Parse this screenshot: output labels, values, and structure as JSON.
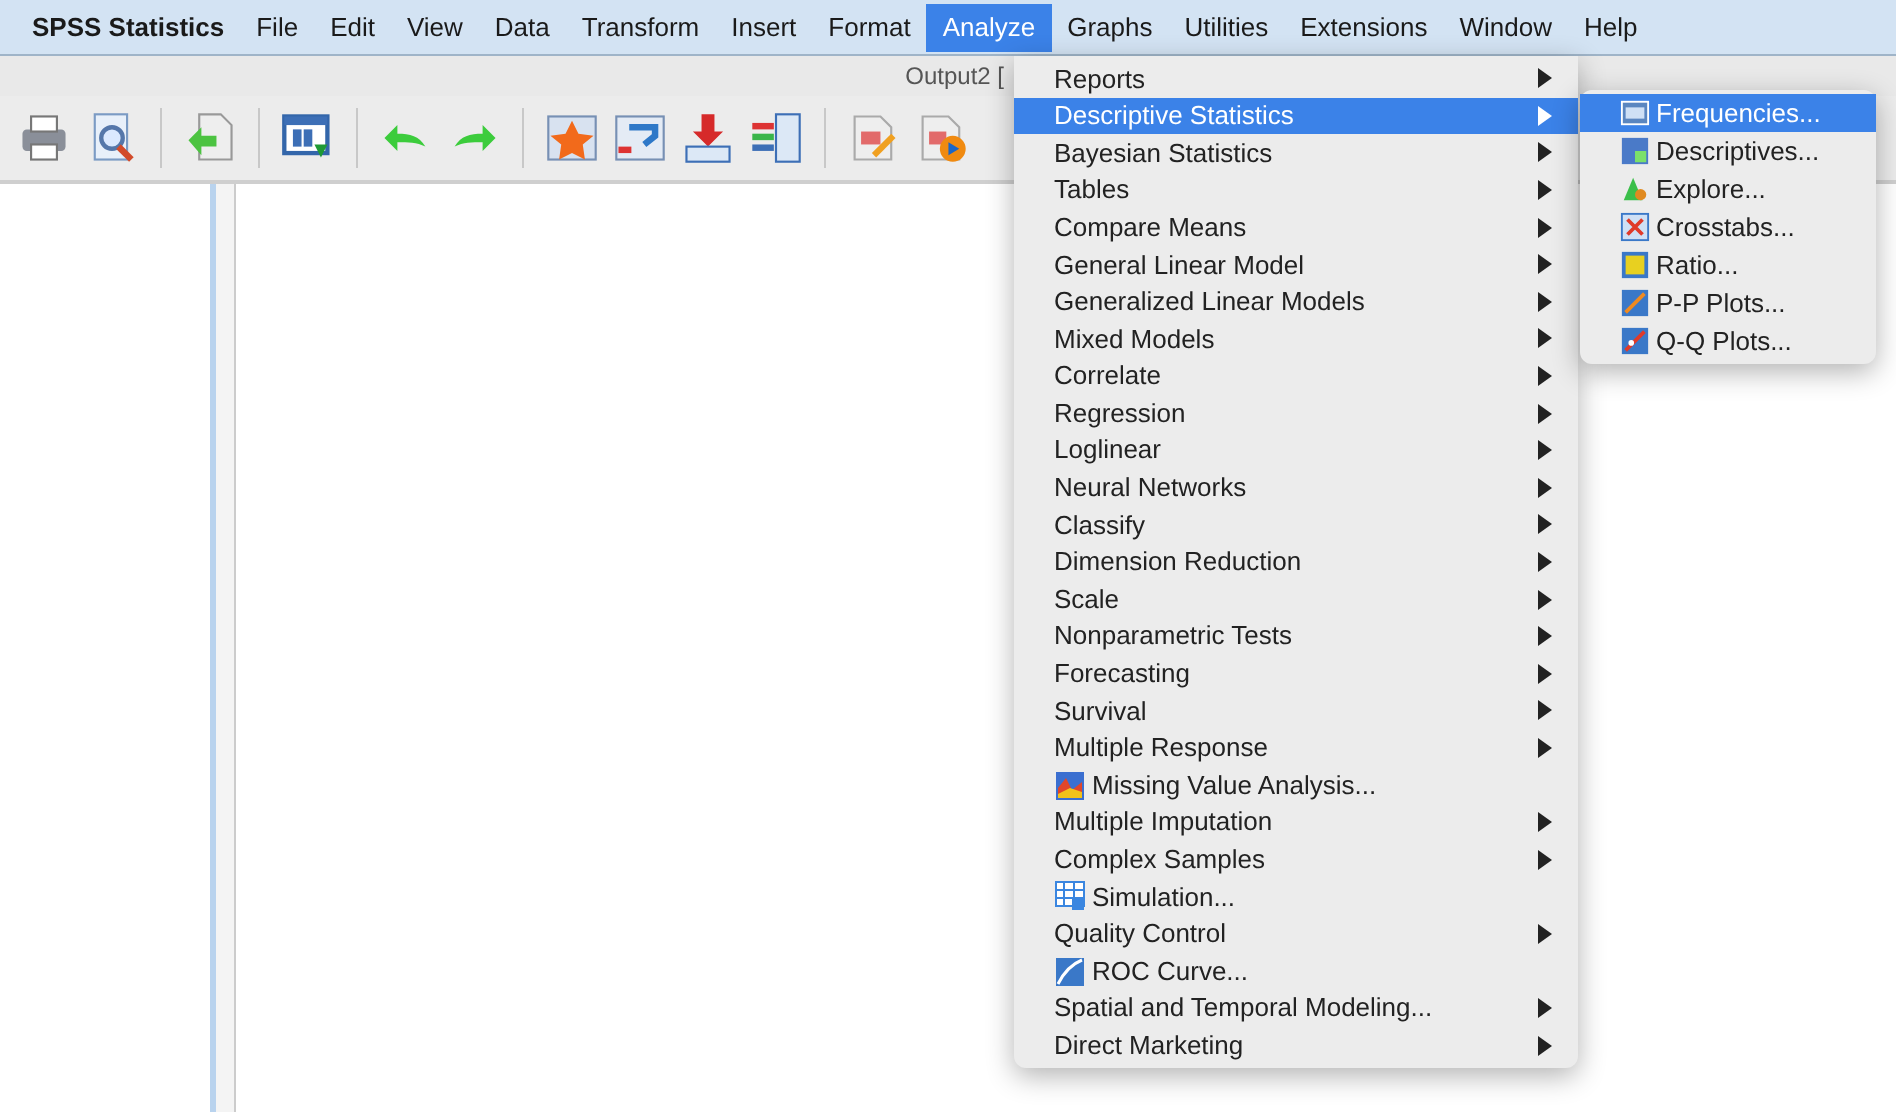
{
  "menu_bar": [
    {
      "label": "SPSS Statistics",
      "selected": false,
      "app": true
    },
    {
      "label": "File",
      "selected": false
    },
    {
      "label": "Edit",
      "selected": false
    },
    {
      "label": "View",
      "selected": false
    },
    {
      "label": "Data",
      "selected": false
    },
    {
      "label": "Transform",
      "selected": false
    },
    {
      "label": "Insert",
      "selected": false
    },
    {
      "label": "Format",
      "selected": false
    },
    {
      "label": "Analyze",
      "selected": true
    },
    {
      "label": "Graphs",
      "selected": false
    },
    {
      "label": "Utilities",
      "selected": false
    },
    {
      "label": "Extensions",
      "selected": false
    },
    {
      "label": "Window",
      "selected": false
    },
    {
      "label": "Help",
      "selected": false
    }
  ],
  "window": {
    "title": "Output2 ["
  },
  "analyze_menu": [
    {
      "label": "Reports",
      "kind": "plain",
      "submenu": true,
      "selected": false
    },
    {
      "label": "Descriptive Statistics",
      "kind": "plain",
      "submenu": true,
      "selected": true
    },
    {
      "label": "Bayesian Statistics",
      "kind": "plain",
      "submenu": true,
      "selected": false
    },
    {
      "label": "Tables",
      "kind": "plain",
      "submenu": true,
      "selected": false
    },
    {
      "label": "Compare Means",
      "kind": "plain",
      "submenu": true,
      "selected": false
    },
    {
      "label": "General Linear Model",
      "kind": "plain",
      "submenu": true,
      "selected": false
    },
    {
      "label": "Generalized Linear Models",
      "kind": "plain",
      "submenu": true,
      "selected": false
    },
    {
      "label": "Mixed Models",
      "kind": "plain",
      "submenu": true,
      "selected": false
    },
    {
      "label": "Correlate",
      "kind": "plain",
      "submenu": true,
      "selected": false
    },
    {
      "label": "Regression",
      "kind": "plain",
      "submenu": true,
      "selected": false
    },
    {
      "label": "Loglinear",
      "kind": "plain",
      "submenu": true,
      "selected": false
    },
    {
      "label": "Neural Networks",
      "kind": "plain",
      "submenu": true,
      "selected": false
    },
    {
      "label": "Classify",
      "kind": "plain",
      "submenu": true,
      "selected": false
    },
    {
      "label": "Dimension Reduction",
      "kind": "plain",
      "submenu": true,
      "selected": false
    },
    {
      "label": "Scale",
      "kind": "plain",
      "submenu": true,
      "selected": false
    },
    {
      "label": "Nonparametric Tests",
      "kind": "plain",
      "submenu": true,
      "selected": false
    },
    {
      "label": "Forecasting",
      "kind": "plain",
      "submenu": true,
      "selected": false
    },
    {
      "label": "Survival",
      "kind": "plain",
      "submenu": true,
      "selected": false
    },
    {
      "label": "Multiple Response",
      "kind": "plain",
      "submenu": true,
      "selected": false
    },
    {
      "label": "Missing Value Analysis...",
      "kind": "icon",
      "submenu": false,
      "selected": false
    },
    {
      "label": "Multiple Imputation",
      "kind": "plain",
      "submenu": true,
      "selected": false
    },
    {
      "label": "Complex Samples",
      "kind": "plain",
      "submenu": true,
      "selected": false
    },
    {
      "label": "Simulation...",
      "kind": "icon",
      "submenu": false,
      "selected": false
    },
    {
      "label": "Quality Control",
      "kind": "plain",
      "submenu": true,
      "selected": false
    },
    {
      "label": "ROC Curve...",
      "kind": "icon",
      "submenu": false,
      "selected": false
    },
    {
      "label": "Spatial and Temporal Modeling...",
      "kind": "plain",
      "submenu": true,
      "selected": false
    },
    {
      "label": "Direct Marketing",
      "kind": "plain",
      "submenu": true,
      "selected": false
    }
  ],
  "descriptive_submenu": [
    {
      "label": "Frequencies...",
      "selected": true
    },
    {
      "label": "Descriptives...",
      "selected": false
    },
    {
      "label": "Explore...",
      "selected": false
    },
    {
      "label": "Crosstabs...",
      "selected": false
    },
    {
      "label": "Ratio...",
      "selected": false
    },
    {
      "label": "P-P Plots...",
      "selected": false
    },
    {
      "label": "Q-Q Plots...",
      "selected": false
    }
  ]
}
